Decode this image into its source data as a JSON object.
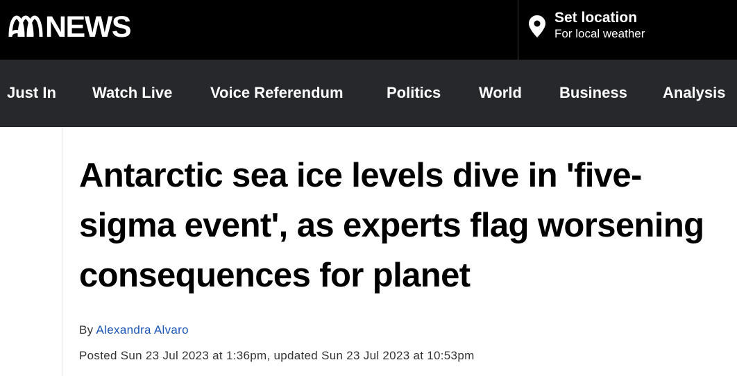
{
  "header": {
    "logo_text": "NEWS",
    "logo_icon": "abc-lissajous-logo",
    "location_title": "Set location",
    "location_subtitle": "For local weather",
    "location_icon": "map-pin-icon"
  },
  "nav": {
    "items": [
      {
        "label": "Just In"
      },
      {
        "label": "Watch Live"
      },
      {
        "label": "Voice Referendum"
      },
      {
        "label": "Politics"
      },
      {
        "label": "World"
      },
      {
        "label": "Business"
      },
      {
        "label": "Analysis"
      }
    ]
  },
  "article": {
    "headline": "Antarctic sea ice levels dive in 'five-sigma event', as experts flag worsening consequences for planet",
    "byline_prefix": "By",
    "author": "Alexandra Alvaro",
    "timestamp": "Posted Sun 23 Jul 2023 at 1:36pm, updated Sun 23 Jul 2023 at 10:53pm"
  },
  "colors": {
    "topbar": "#000000",
    "navbar": "#26282b",
    "author_link": "#1a56b8"
  }
}
